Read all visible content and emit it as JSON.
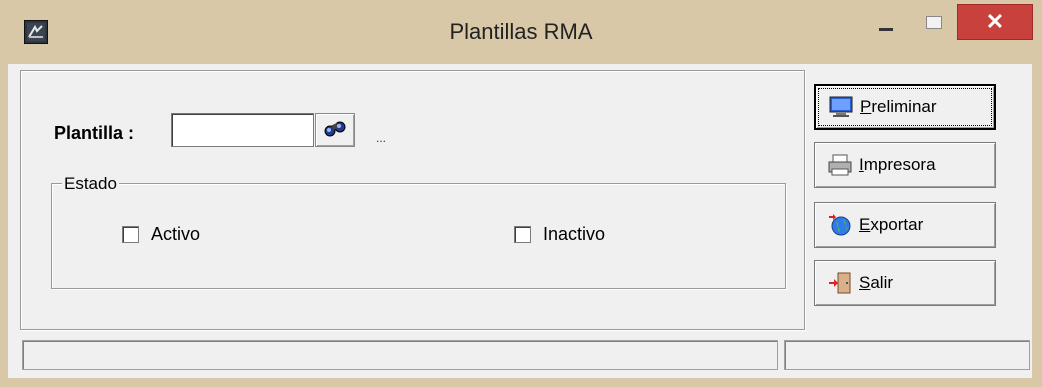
{
  "window": {
    "title": "Plantillas RMA",
    "close_symbol": "✕"
  },
  "form": {
    "plantilla_label": "Plantilla :",
    "plantilla_value": "",
    "lookup_icon": "binoculars-icon",
    "ellipsis": "..."
  },
  "estado": {
    "legend": "Estado",
    "options": [
      {
        "label": "Activo",
        "checked": false
      },
      {
        "label": "Inactivo",
        "checked": false
      }
    ]
  },
  "actions": {
    "preliminar": "Preliminar",
    "impresora": "Impresora",
    "exportar": "Exportar",
    "salir": "Salir"
  },
  "statusbar": {
    "left": "",
    "right": ""
  },
  "colors": {
    "frame": "#d8c8a8",
    "close": "#c8413c",
    "client": "#f0f0f0"
  }
}
